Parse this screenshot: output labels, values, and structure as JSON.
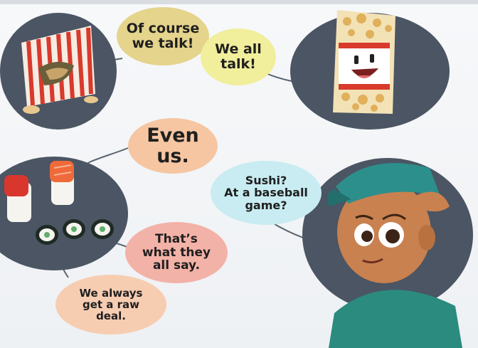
{
  "bubbles": {
    "of_course": "Of course\nwe talk!",
    "we_all": "We all\ntalk!",
    "even_us": "Even\nus.",
    "sushi": "Sushi?\nAt a baseball\ngame?",
    "thats_what": "That’s\nwhat they\nall say.",
    "raw_deal": "We always\nget a raw\ndeal."
  },
  "colors": {
    "blob": "#4b5563",
    "popcorn_red": "#d83a2c",
    "salmon": "#ef6a3a",
    "tuna": "#d9362e",
    "cap": "#2d8f8c",
    "skin": "#c9814f"
  }
}
